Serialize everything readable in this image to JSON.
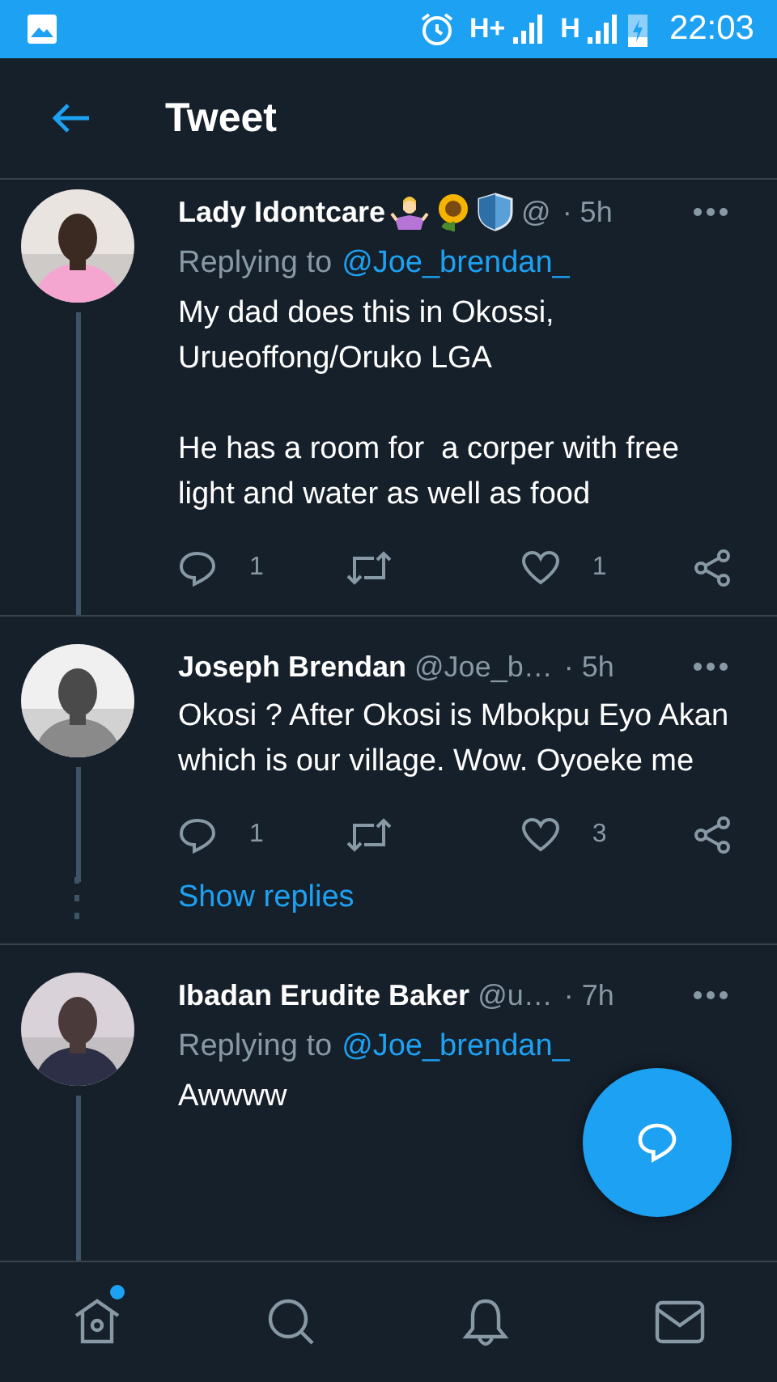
{
  "status_bar": {
    "time": "22:03",
    "network_1": "H+",
    "network_2": "H"
  },
  "header": {
    "title": "Tweet"
  },
  "tweets": [
    {
      "name": "Lady Idontcare",
      "badges": [
        {
          "kind": "shrug"
        },
        {
          "kind": "sunflower"
        },
        {
          "kind": "shield"
        }
      ],
      "handle": "@",
      "time": "· 5h",
      "replying_prefix": "Replying to",
      "replying_to": "@Joe_brendan_",
      "body": [
        "My dad does this in Okossi,\nUrueoffong/Oruko LGA",
        "He has a room for  a corper with free light and water as well as food"
      ],
      "replies": "1",
      "likes": "1"
    },
    {
      "name": "Joseph Brendan",
      "handle": "@Joe_b…",
      "time": "· 5h",
      "body": [
        "Okosi ? After Okosi is Mbokpu Eyo Akan which is our village. Wow. Oyoeke me"
      ],
      "replies": "1",
      "likes": "3",
      "show_replies": "Show replies"
    },
    {
      "name": "Ibadan Erudite Baker",
      "handle": "@u…",
      "time": "· 7h",
      "replying_prefix": "Replying to",
      "replying_to": "@Joe_brendan_",
      "body": [
        "Awwww"
      ]
    }
  ],
  "nav": [
    {
      "kind": "home",
      "has_new": true
    },
    {
      "kind": "search",
      "has_new": false
    },
    {
      "kind": "bell",
      "has_new": false
    },
    {
      "kind": "mail",
      "has_new": false
    }
  ]
}
